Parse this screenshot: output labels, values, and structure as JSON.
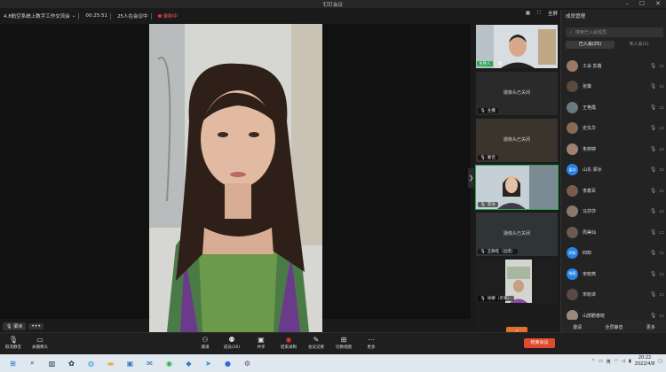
{
  "window": {
    "title": "钉钉会议"
  },
  "info": {
    "meeting_name": "4.8航空系统上数字工作交流会",
    "elapsed": "00:25:51",
    "attendance": "25人在会议中",
    "recording": "录制中",
    "fullscreen": "全屏"
  },
  "speaker": {
    "name": "梁冰",
    "more": "•••"
  },
  "gallery": {
    "host_badge": "主持人",
    "host_name": "我",
    "cam_off_text": "摄像头已关闭",
    "tiles": [
      {
        "label": "主播"
      },
      {
        "label": "秦佳"
      },
      {
        "label": "李冰"
      },
      {
        "label": "王静旺（出席）"
      },
      {
        "label": "徐娜（老师）"
      }
    ]
  },
  "panel": {
    "title": "成员管理",
    "search_placeholder": "搜索已入会成员",
    "tab_joined": "已入会(25)",
    "tab_not_joined": "未入会(1)",
    "members": [
      {
        "name": "工会 彭鑫",
        "avatar_text": ""
      },
      {
        "name": "张策",
        "avatar_text": ""
      },
      {
        "name": "王艳霞",
        "avatar_text": ""
      },
      {
        "name": "史先华",
        "avatar_text": ""
      },
      {
        "name": "朱婷婷",
        "avatar_text": ""
      },
      {
        "name": "山东 梁冰",
        "avatar_text": "梁冰"
      },
      {
        "name": "李鑫军",
        "avatar_text": ""
      },
      {
        "name": "马莎莎",
        "avatar_text": ""
      },
      {
        "name": "周美仙",
        "avatar_text": ""
      },
      {
        "name": "四知",
        "avatar_text": "四知"
      },
      {
        "name": "宋晓燕",
        "avatar_text": "晓燕"
      },
      {
        "name": "宋晓卓",
        "avatar_text": ""
      },
      {
        "name": "山部鹏春晓",
        "avatar_text": ""
      }
    ],
    "footer": {
      "invite": "邀请",
      "mute_all": "全员静音",
      "more": "更多"
    }
  },
  "toolbar": {
    "unmute": "取消静音",
    "camera": "关摄像头",
    "invite": "邀请",
    "members": "成员(26)",
    "share": "共享",
    "end_record": "结束录制",
    "minutes": "会议记要",
    "switch_view": "切换视图",
    "more": "更多",
    "end_meeting": "结束会议"
  },
  "taskbar": {
    "time": "20:22",
    "date": "2022/4/8",
    "ime": "英"
  },
  "colors": {
    "accent_green": "#2aa54a",
    "end_red": "#e24a2c",
    "record_red": "#ee3333"
  }
}
